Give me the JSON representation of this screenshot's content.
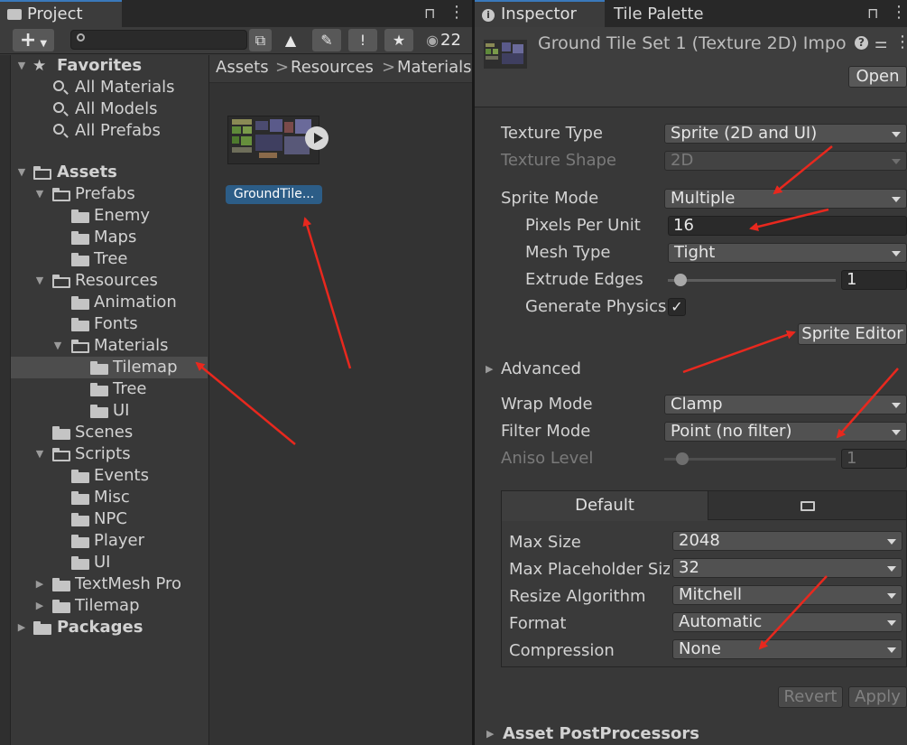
{
  "project_window": {
    "tab_label": "Project",
    "toolbar": {
      "add_label": "+",
      "badge_count": "22"
    },
    "tree": [
      {
        "label": "Favorites",
        "type": "header"
      },
      {
        "label": "All Materials",
        "type": "search"
      },
      {
        "label": "All Models",
        "type": "search"
      },
      {
        "label": "All Prefabs",
        "type": "search"
      },
      {
        "label": "Assets",
        "type": "root"
      },
      {
        "label": "Prefabs"
      },
      {
        "label": "Enemy"
      },
      {
        "label": "Maps"
      },
      {
        "label": "Tree"
      },
      {
        "label": "Resources"
      },
      {
        "label": "Animation"
      },
      {
        "label": "Fonts"
      },
      {
        "label": "Materials"
      },
      {
        "label": "Tilemap",
        "selected": true
      },
      {
        "label": "Tree"
      },
      {
        "label": "UI"
      },
      {
        "label": "Scenes"
      },
      {
        "label": "Scripts"
      },
      {
        "label": "Events"
      },
      {
        "label": "Misc"
      },
      {
        "label": "NPC"
      },
      {
        "label": "Player"
      },
      {
        "label": "UI"
      },
      {
        "label": "TextMesh Pro"
      },
      {
        "label": "Tilemap"
      },
      {
        "label": "Packages",
        "type": "root"
      }
    ],
    "breadcrumb": [
      "Assets",
      ">",
      "Resources",
      ">",
      "Materials"
    ],
    "asset": {
      "label": "GroundTile..."
    }
  },
  "inspector": {
    "tabs": [
      "Inspector",
      "Tile Palette"
    ],
    "title": "Ground Tile Set 1 (Texture 2D) Impo",
    "open_button": "Open",
    "fields": {
      "texture_type": {
        "label": "Texture Type",
        "value": "Sprite (2D and UI)"
      },
      "texture_shape": {
        "label": "Texture Shape",
        "value": "2D"
      },
      "sprite_mode": {
        "label": "Sprite Mode",
        "value": "Multiple"
      },
      "pixels_per_unit": {
        "label": "Pixels Per Unit",
        "value": "16"
      },
      "mesh_type": {
        "label": "Mesh Type",
        "value": "Tight"
      },
      "extrude_edges": {
        "label": "Extrude Edges",
        "value": "1"
      },
      "generate_physics": {
        "label": "Generate Physics",
        "checked": true
      },
      "sprite_editor_button": "Sprite Editor",
      "advanced": "Advanced",
      "wrap_mode": {
        "label": "Wrap Mode",
        "value": "Clamp"
      },
      "filter_mode": {
        "label": "Filter Mode",
        "value": "Point (no filter)"
      },
      "aniso_level": {
        "label": "Aniso Level",
        "value": "1"
      }
    },
    "platform": {
      "default_tab": "Default",
      "max_size": {
        "label": "Max Size",
        "value": "2048"
      },
      "max_placeholder": {
        "label": "Max Placeholder Siz",
        "value": "32"
      },
      "resize_algorithm": {
        "label": "Resize Algorithm",
        "value": "Mitchell"
      },
      "format": {
        "label": "Format",
        "value": "Automatic"
      },
      "compression": {
        "label": "Compression",
        "value": "None"
      }
    },
    "revert_button": "Revert",
    "apply_button": "Apply",
    "asset_postprocessors": "Asset PostProcessors"
  },
  "colors": {
    "annotation_arrow": "#e8281e",
    "selection": "#2c5d87",
    "tab_accent": "#3a79bb"
  }
}
